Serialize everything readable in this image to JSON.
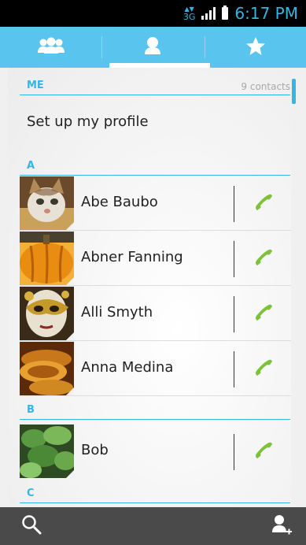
{
  "status_bar": {
    "network": "3G",
    "time": "6:17 PM"
  },
  "tabs": [
    {
      "icon": "groups-icon",
      "selected": false
    },
    {
      "icon": "contact-icon",
      "selected": true
    },
    {
      "icon": "star-icon",
      "selected": false
    }
  ],
  "sections": {
    "me": {
      "title": "ME",
      "count": "9 contacts"
    },
    "a": {
      "title": "A"
    },
    "b": {
      "title": "B"
    },
    "c": {
      "title": "C"
    }
  },
  "profile": {
    "label": "Set up my profile"
  },
  "contacts": [
    {
      "name": "Abe Baubo",
      "photo": "cat"
    },
    {
      "name": "Abner Fanning",
      "photo": "pumpkin"
    },
    {
      "name": "Alli Smyth",
      "photo": "mask"
    },
    {
      "name": "Anna Medina",
      "photo": "bowl"
    },
    {
      "name": "Bob",
      "photo": "leaves"
    }
  ],
  "bottom_bar": {
    "left_icon": "search-icon",
    "right_icon": "add-contact-icon"
  },
  "colors": {
    "accent": "#33b5e5",
    "tab_bar": "#59c4ed",
    "call_icon": "#7cc23a",
    "bottom_bar": "#4a4a4a"
  }
}
